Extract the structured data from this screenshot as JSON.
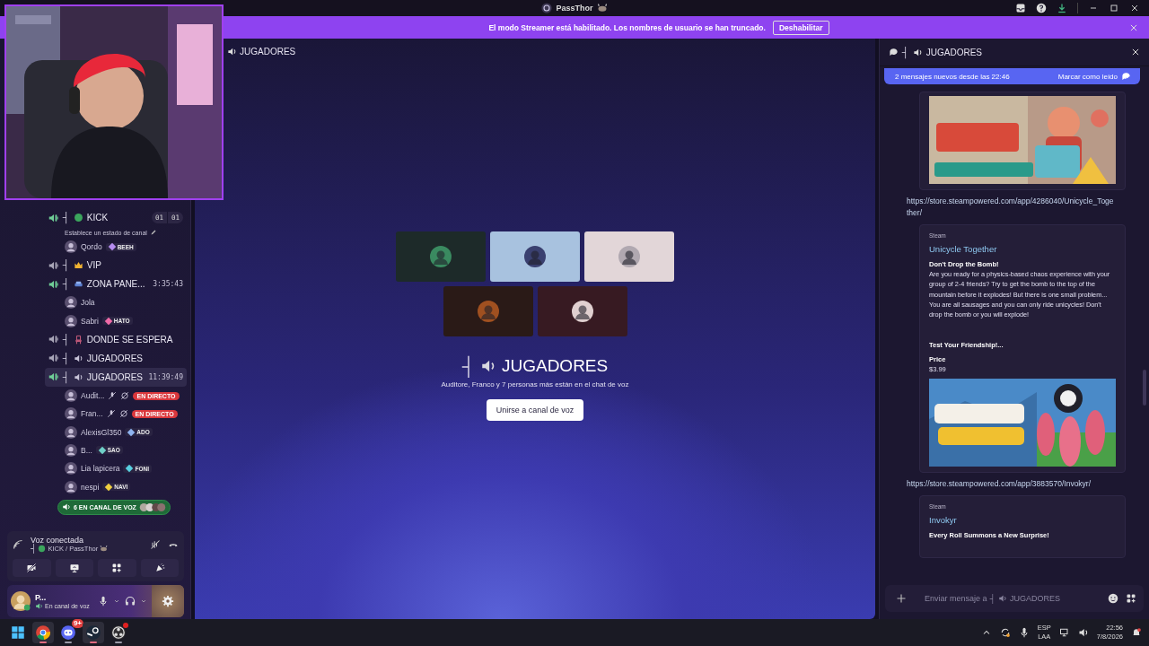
{
  "title_bar": {
    "server": "PassThor"
  },
  "streamer_banner": {
    "message": "El modo Streamer está habilitado. Los nombres de usuario se han truncado.",
    "button": "Deshabilitar"
  },
  "sidebar": {
    "channels": [
      {
        "kind": "status",
        "prefix": "┤",
        "name": "KICK",
        "active": true,
        "selected": false,
        "counters": [
          "01",
          "01"
        ],
        "status": "Establece un estado de canal",
        "users": [
          {
            "name": "Qordo",
            "badge": "BEEH",
            "color": "#b68cf0"
          }
        ]
      },
      {
        "kind": "crown",
        "prefix": "┤",
        "name": "VIP",
        "active": false,
        "selected": false
      },
      {
        "kind": "sofa",
        "prefix": "┤",
        "name": "ZONA PANE...",
        "active": true,
        "selected": false,
        "timer": "3:35:43",
        "users": [
          {
            "name": "Jola"
          },
          {
            "name": "Sabri",
            "badge": "HATO",
            "color": "#f06aa8"
          }
        ]
      },
      {
        "kind": "chair",
        "prefix": "┤",
        "name": "DONDE SE ESPERA",
        "active": false,
        "selected": false
      },
      {
        "kind": "speaker",
        "prefix": "┤",
        "name": "JUGADORES",
        "active": false,
        "selected": false
      },
      {
        "kind": "speaker",
        "prefix": "┤",
        "name": "JUGADORES",
        "active": true,
        "selected": true,
        "timer": "11:39:49",
        "users": [
          {
            "name": "Audit...",
            "muted": true,
            "live": "EN DIRECTO"
          },
          {
            "name": "Fran...",
            "muted": true,
            "live": "EN DIRECTO"
          },
          {
            "name": "AlexisGl350",
            "badge": "ADO",
            "color": "#8fb4f0"
          },
          {
            "name": "B...",
            "badge": "SAO",
            "color": "#6fd0c8"
          },
          {
            "name": "Lia lapicera",
            "badge": "FONI",
            "color": "#58d0e0"
          },
          {
            "name": "nespi",
            "badge": "NAVI",
            "color": "#f0d040"
          }
        ]
      }
    ],
    "voice_count": "6 EN CANAL DE VOZ"
  },
  "voice_panel": {
    "status": "Voz conectada",
    "prefix": "┤",
    "channel": "KICK / PassThor"
  },
  "user_panel": {
    "name": "P...",
    "status": "En canal de voz"
  },
  "main": {
    "header": "JUGADORES",
    "tiles": [
      {
        "color": "#1d2a29"
      },
      {
        "color": "#a8c2df"
      },
      {
        "color": "#e2d6d8"
      },
      {
        "color": "#2a1a17"
      },
      {
        "color": "#371a22"
      }
    ],
    "prefix": "┤",
    "title": "JUGADORES",
    "subtitle": "Auditore, Franco y 7 personas más están en el chat de voz",
    "button": "Unirse a canal de voz"
  },
  "chat": {
    "prefix": "┤",
    "title": "JUGADORES",
    "new_messages": {
      "text": "2 mensajes nuevos desde las 22:46",
      "action": "Marcar como leído"
    },
    "messages": [
      {
        "kind": "embed",
        "has_image": true
      },
      {
        "kind": "link",
        "url": "https://store.steampowered.com/app/4286040/Unicycle_Together/"
      },
      {
        "kind": "embed",
        "provider": "Steam",
        "title": "Unicycle Together",
        "heading": "Don't Drop the Bomb!",
        "description": "Are you ready for a physics-based chaos experience with your group of 2-4 friends? Try to get the bomb to the top of the mountain before it explodes! But there is one small problem... You are all sausages and you can only ride unicycles! Don't drop the bomb or you will explode!",
        "subheading": "Test Your Friendship!...",
        "field_name": "Price",
        "field_value": "$3.99",
        "has_image": true
      },
      {
        "kind": "link",
        "url": "https://store.steampowered.com/app/3883570/Invokyr/"
      },
      {
        "kind": "embed",
        "provider": "Steam",
        "title": "Invokyr",
        "heading": "Every Roll Summons a New Surprise!"
      }
    ],
    "placeholder": {
      "lead": "Enviar mensaje a",
      "prefix": "┤",
      "channel": "JUGADORES"
    }
  },
  "taskbar": {
    "apps": [
      {
        "kind": "start",
        "active": false,
        "running": false
      },
      {
        "kind": "chrome",
        "active": true,
        "running": true
      },
      {
        "kind": "discord",
        "active": false,
        "running": true,
        "badge": "9+"
      },
      {
        "kind": "steam",
        "active": true,
        "running": true
      },
      {
        "kind": "obs",
        "active": false,
        "running": true,
        "alert": true
      }
    ],
    "language": "ESP",
    "layout": "LAA",
    "time": "22:56",
    "date": "7/8/2026"
  }
}
